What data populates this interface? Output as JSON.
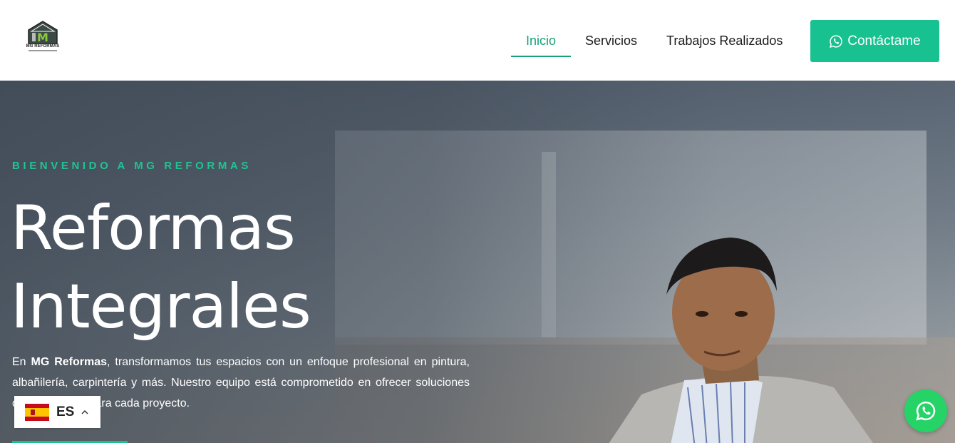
{
  "header": {
    "logo_text": "MG REFORMAS",
    "nav": [
      {
        "label": "Inicio",
        "active": true
      },
      {
        "label": "Servicios",
        "active": false
      },
      {
        "label": "Trabajos Realizados",
        "active": false
      }
    ],
    "cta_label": "Contáctame",
    "cta_icon": "whatsapp-icon"
  },
  "hero": {
    "eyebrow": "BIENVENIDO A MG REFORMAS",
    "title_line1": "Reformas",
    "title_line2": "Integrales",
    "desc_pre": "En ",
    "desc_brand": "MG Reformas",
    "desc_post": ", transformamos tus espacios con un enfoque profesional en pintura, albañilería, carpintería y más. Nuestro equipo está comprometido en ofrecer soluciones de alta calidad para cada proyecto."
  },
  "language": {
    "code": "ES",
    "flag": "spain-flag-icon"
  },
  "floating": {
    "icon": "whatsapp-icon"
  },
  "colors": {
    "accent": "#17c190",
    "nav_active": "#1aa179",
    "whatsapp": "#25d366"
  }
}
